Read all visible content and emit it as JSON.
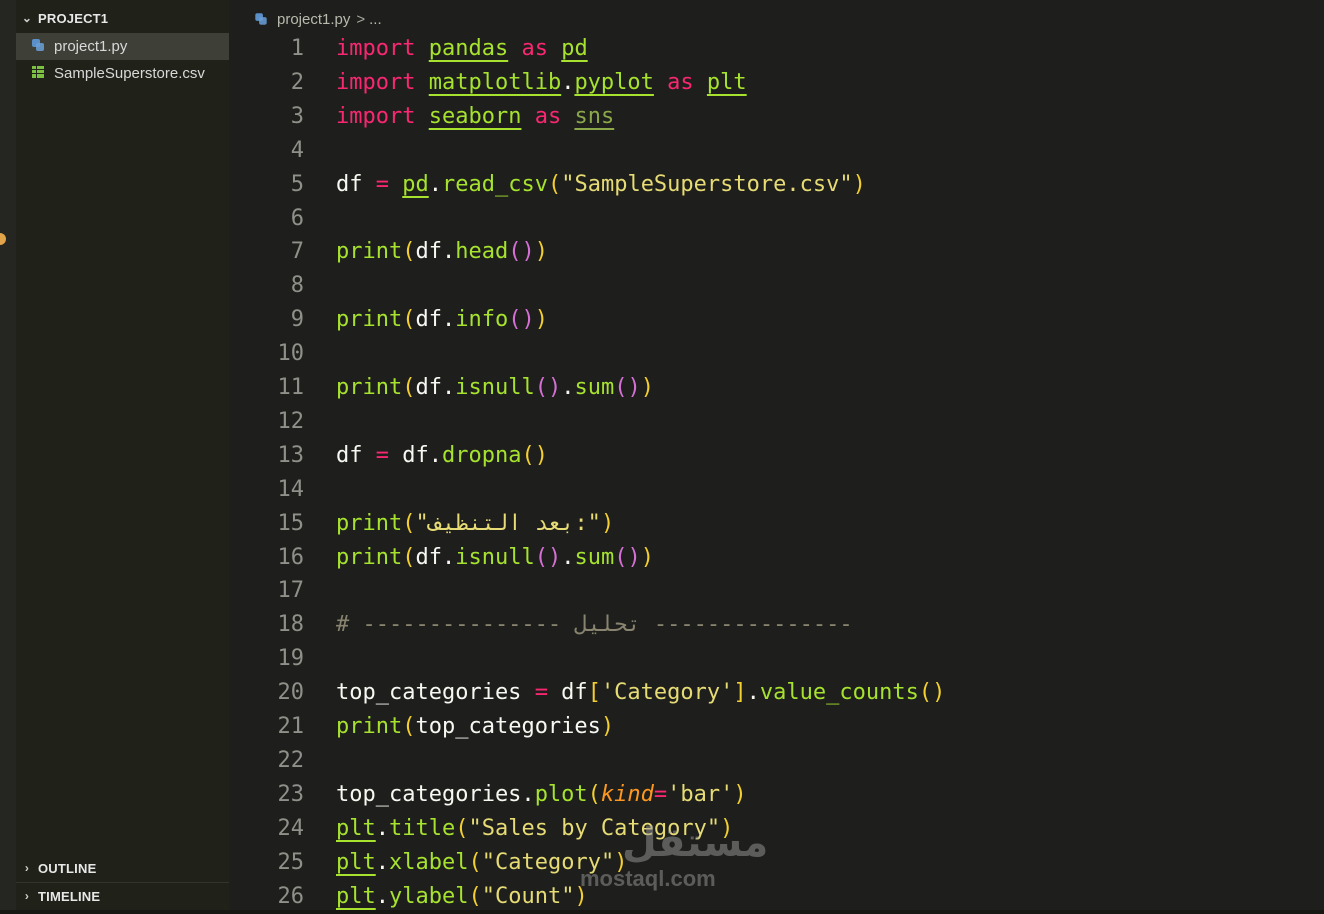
{
  "explorer": {
    "project_title": "PROJECT1",
    "files": [
      {
        "name": "project1.py",
        "icon": "python-file-icon",
        "selected": true
      },
      {
        "name": "SampleSuperstore.csv",
        "icon": "csv-file-icon",
        "selected": false
      }
    ],
    "outline_label": "OUTLINE",
    "timeline_label": "TIMELINE"
  },
  "breadcrumb": {
    "file": "project1.py",
    "separator": ">",
    "ellipsis": "..."
  },
  "editor": {
    "line_numbers": [
      "1",
      "2",
      "3",
      "4",
      "5",
      "6",
      "7",
      "8",
      "9",
      "10",
      "11",
      "12",
      "13",
      "14",
      "15",
      "16",
      "17",
      "18",
      "19",
      "20",
      "21",
      "22",
      "23",
      "24",
      "25",
      "26"
    ],
    "lines": [
      [
        [
          "kw",
          "import"
        ],
        [
          "var",
          " "
        ],
        [
          "mod",
          "pandas"
        ],
        [
          "var",
          " "
        ],
        [
          "kw",
          "as"
        ],
        [
          "var",
          " "
        ],
        [
          "mod",
          "pd"
        ]
      ],
      [
        [
          "kw",
          "import"
        ],
        [
          "var",
          " "
        ],
        [
          "mod",
          "matplotlib"
        ],
        [
          "var",
          "."
        ],
        [
          "mod",
          "pyplot"
        ],
        [
          "var",
          " "
        ],
        [
          "kw",
          "as"
        ],
        [
          "var",
          " "
        ],
        [
          "mod",
          "plt"
        ]
      ],
      [
        [
          "kw",
          "import"
        ],
        [
          "var",
          " "
        ],
        [
          "mod",
          "seaborn"
        ],
        [
          "var",
          " "
        ],
        [
          "kw",
          "as"
        ],
        [
          "var",
          " "
        ],
        [
          "mod-dim",
          "sns"
        ]
      ],
      [],
      [
        [
          "var",
          "df "
        ],
        [
          "op",
          "="
        ],
        [
          "var",
          " "
        ],
        [
          "mod",
          "pd"
        ],
        [
          "var",
          "."
        ],
        [
          "fn",
          "read_csv"
        ],
        [
          "p1",
          "("
        ],
        [
          "str",
          "\"SampleSuperstore.csv\""
        ],
        [
          "p1",
          ")"
        ]
      ],
      [],
      [
        [
          "fn",
          "print"
        ],
        [
          "p1",
          "("
        ],
        [
          "var",
          "df."
        ],
        [
          "fn",
          "head"
        ],
        [
          "p2",
          "()"
        ],
        [
          "p1",
          ")"
        ]
      ],
      [],
      [
        [
          "fn",
          "print"
        ],
        [
          "p1",
          "("
        ],
        [
          "var",
          "df."
        ],
        [
          "fn",
          "info"
        ],
        [
          "p2",
          "()"
        ],
        [
          "p1",
          ")"
        ]
      ],
      [],
      [
        [
          "fn",
          "print"
        ],
        [
          "p1",
          "("
        ],
        [
          "var",
          "df."
        ],
        [
          "fn",
          "isnull"
        ],
        [
          "p2",
          "()"
        ],
        [
          "var",
          "."
        ],
        [
          "fn",
          "sum"
        ],
        [
          "p2",
          "()"
        ],
        [
          "p1",
          ")"
        ]
      ],
      [],
      [
        [
          "var",
          "df "
        ],
        [
          "op",
          "="
        ],
        [
          "var",
          " df."
        ],
        [
          "fn",
          "dropna"
        ],
        [
          "p1",
          "()"
        ]
      ],
      [],
      [
        [
          "fn",
          "print"
        ],
        [
          "p1",
          "("
        ],
        [
          "str",
          "\"بعد التنظيف:\""
        ],
        [
          "p1",
          ")"
        ]
      ],
      [
        [
          "fn",
          "print"
        ],
        [
          "p1",
          "("
        ],
        [
          "var",
          "df."
        ],
        [
          "fn",
          "isnull"
        ],
        [
          "p2",
          "()"
        ],
        [
          "var",
          "."
        ],
        [
          "fn",
          "sum"
        ],
        [
          "p2",
          "()"
        ],
        [
          "p1",
          ")"
        ]
      ],
      [],
      [
        [
          "cm",
          "# --------------- تحليل ---------------"
        ]
      ],
      [],
      [
        [
          "var",
          "top_categories "
        ],
        [
          "op",
          "="
        ],
        [
          "var",
          " df"
        ],
        [
          "p1",
          "["
        ],
        [
          "str",
          "'Category'"
        ],
        [
          "p1",
          "]"
        ],
        [
          "var",
          "."
        ],
        [
          "fn",
          "value_counts"
        ],
        [
          "p1",
          "()"
        ]
      ],
      [
        [
          "fn",
          "print"
        ],
        [
          "p1",
          "("
        ],
        [
          "var",
          "top_categories"
        ],
        [
          "p1",
          ")"
        ]
      ],
      [],
      [
        [
          "var",
          "top_categories."
        ],
        [
          "fn",
          "plot"
        ],
        [
          "p1",
          "("
        ],
        [
          "arg",
          "kind"
        ],
        [
          "op",
          "="
        ],
        [
          "str",
          "'bar'"
        ],
        [
          "p1",
          ")"
        ]
      ],
      [
        [
          "mod",
          "plt"
        ],
        [
          "var",
          "."
        ],
        [
          "fn",
          "title"
        ],
        [
          "p1",
          "("
        ],
        [
          "str",
          "\"Sales by Category\""
        ],
        [
          "p1",
          ")"
        ]
      ],
      [
        [
          "mod",
          "plt"
        ],
        [
          "var",
          "."
        ],
        [
          "fn",
          "xlabel"
        ],
        [
          "p1",
          "("
        ],
        [
          "str",
          "\"Category\""
        ],
        [
          "p1",
          ")"
        ]
      ],
      [
        [
          "mod",
          "plt"
        ],
        [
          "var",
          "."
        ],
        [
          "fn",
          "ylabel"
        ],
        [
          "p1",
          "("
        ],
        [
          "str",
          "\"Count\""
        ],
        [
          "p1",
          ")"
        ]
      ]
    ]
  },
  "watermark": {
    "logo_text": "مستقل",
    "site_text": "mostaql.com"
  },
  "colors": {
    "keyword": "#f92672",
    "function": "#a6e22e",
    "string": "#e6db74",
    "comment": "#88846f",
    "background": "#1e1f1c"
  }
}
